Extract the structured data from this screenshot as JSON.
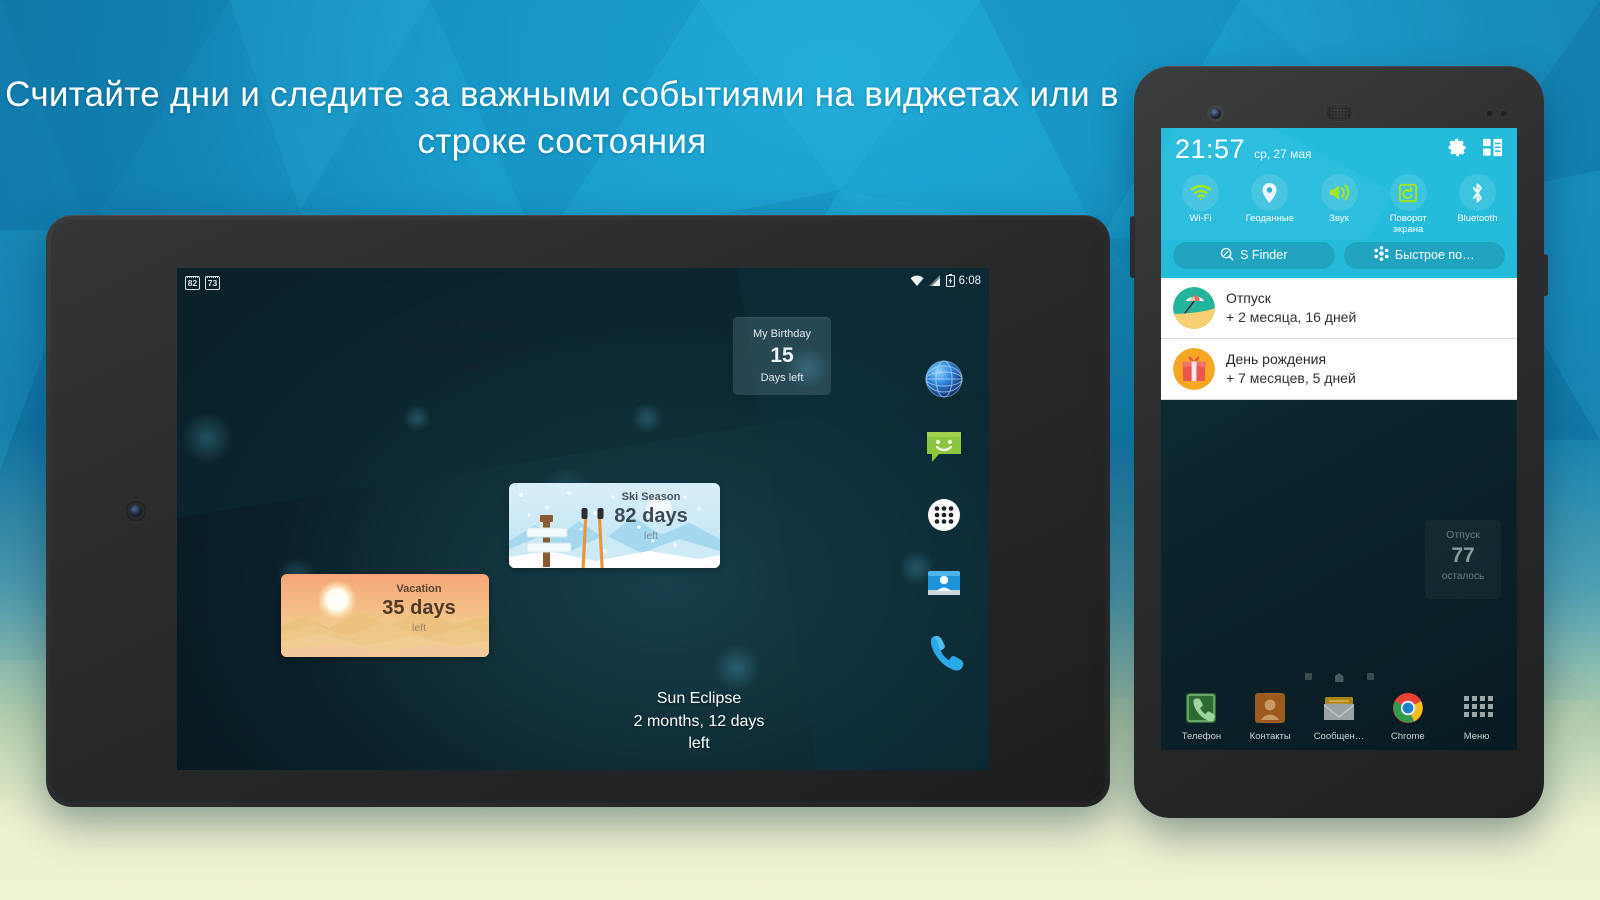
{
  "headline": "Считайте дни и следите за важными событиями на виджетах или в строке состояния",
  "colors": {
    "bg_top": "#14a0d0",
    "bg_bottom": "#eef1d0",
    "panel_accent": "#25bcdc",
    "toggle_on": "#a8e61d",
    "notif_bg": "#ffffff"
  },
  "tablet": {
    "status_bar": {
      "badge_1": "82",
      "badge_2": "73",
      "icons": [
        "wifi-icon",
        "signal-icon",
        "battery-charging-icon"
      ],
      "time": "6:08"
    },
    "widgets": {
      "sun_eclipse_top": {
        "title": "Sun Eclipse",
        "value": "2 months, 12 days",
        "suffix": "left"
      },
      "birthday": {
        "title": "My Birthday",
        "value": "15",
        "suffix": "Days left"
      },
      "ski": {
        "title": "Ski Season",
        "value": "82 days",
        "suffix": "left"
      },
      "vacation": {
        "title": "Vacation",
        "value": "35 days",
        "suffix": "left"
      },
      "sun_eclipse_bottom": {
        "title": "Sun Eclipse",
        "value": "2 months, 12 days",
        "suffix": "left"
      }
    },
    "dock": [
      {
        "name": "browser-icon"
      },
      {
        "name": "messaging-icon"
      },
      {
        "name": "app-drawer-icon"
      },
      {
        "name": "contacts-icon"
      },
      {
        "name": "phone-icon"
      }
    ]
  },
  "phone": {
    "panel": {
      "time": "21:57",
      "date": "ср, 27 мая",
      "settings_icon": "gear-icon",
      "edit_icon": "panel-grid-icon",
      "toggles": [
        {
          "label": "Wi-Fi",
          "icon": "wifi-icon",
          "active": true
        },
        {
          "label": "Геоданные",
          "icon": "location-pin-icon",
          "active": false
        },
        {
          "label": "Звук",
          "icon": "sound-icon",
          "active": true
        },
        {
          "label": "Поворот экрана",
          "icon": "screen-rotate-icon",
          "active": true
        },
        {
          "label": "Bluetooth",
          "icon": "bluetooth-icon",
          "active": false
        }
      ],
      "quick_buttons": [
        {
          "label": "S Finder",
          "icon": "search-circle-icon"
        },
        {
          "label": "Быстрое по…",
          "icon": "quick-connect-icon"
        }
      ],
      "notifications": [
        {
          "title": "Отпуск",
          "subtitle": "+ 2 месяца, 16 дней",
          "icon": "beach-umbrella-icon"
        },
        {
          "title": "День рождения",
          "subtitle": "+ 7 месяцев, 5 дней",
          "icon": "gift-icon"
        }
      ]
    },
    "home_widget": {
      "title": "Отпуск",
      "value": "77",
      "suffix": "осталось"
    },
    "dock": [
      {
        "label": "Телефон",
        "icon": "phone-icon"
      },
      {
        "label": "Контакты",
        "icon": "contacts-icon"
      },
      {
        "label": "Сообщен…",
        "icon": "messages-icon"
      },
      {
        "label": "Chrome",
        "icon": "chrome-icon"
      },
      {
        "label": "Меню",
        "icon": "apps-grid-icon"
      }
    ]
  }
}
